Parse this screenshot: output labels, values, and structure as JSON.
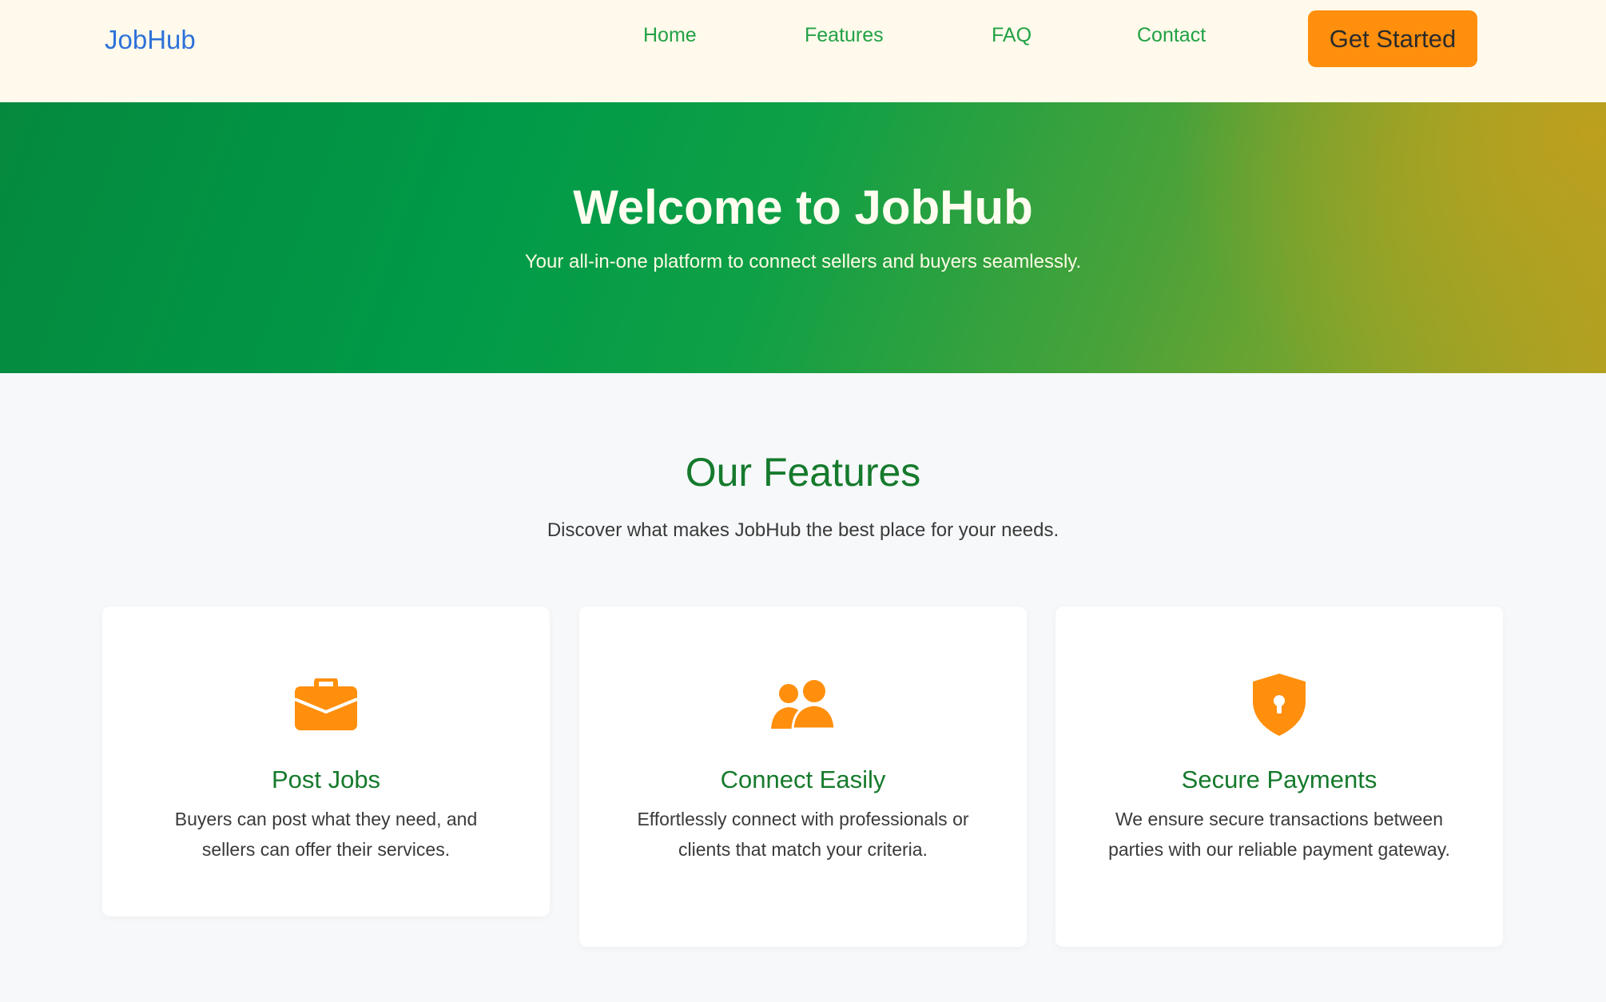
{
  "colors": {
    "brand": "#2f72d9",
    "nav_link": "#22a146",
    "accent_orange": "#ff8f0d",
    "heading_green": "#157a2c",
    "navbar_bg": "#fffaeb",
    "page_bg": "#f6f8fa"
  },
  "navbar": {
    "brand": "JobHub",
    "links": [
      {
        "label": "Home"
      },
      {
        "label": "Features"
      },
      {
        "label": "FAQ"
      },
      {
        "label": "Contact"
      }
    ],
    "cta_label": "Get Started"
  },
  "hero": {
    "title": "Welcome to JobHub",
    "subtitle": "Your all-in-one platform to connect sellers and buyers seamlessly."
  },
  "features": {
    "title": "Our Features",
    "subtitle": "Discover what makes JobHub the best place for your needs.",
    "cards": [
      {
        "icon": "briefcase-icon",
        "title": "Post Jobs",
        "text": "Buyers can post what they need, and sellers can offer their services."
      },
      {
        "icon": "users-icon",
        "title": "Connect Easily",
        "text": "Effortlessly connect with professionals or clients that match your criteria."
      },
      {
        "icon": "shield-lock-icon",
        "title": "Secure Payments",
        "text": "We ensure secure transactions between parties with our reliable payment gateway."
      }
    ]
  }
}
